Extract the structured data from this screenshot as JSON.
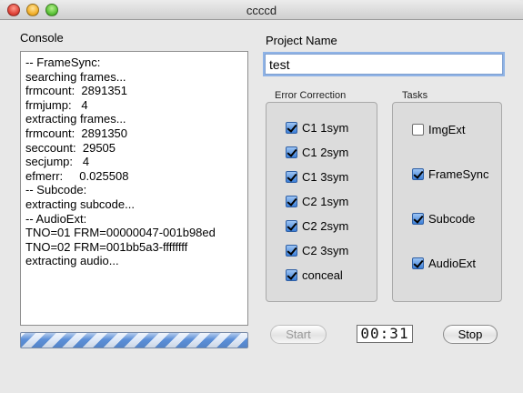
{
  "window": {
    "title": "ccccd"
  },
  "console": {
    "label": "Console",
    "lines": [
      "-- FrameSync:",
      "searching frames...",
      "frmcount:  2891351",
      "frmjump:   4",
      "extracting frames...",
      "frmcount:  2891350",
      "seccount:  29505",
      "secjump:   4",
      "efmerr:     0.025508",
      "-- Subcode:",
      "extracting subcode...",
      "-- AudioExt:",
      "TNO=01 FRM=00000047-001b98ed",
      "TNO=02 FRM=001bb5a3-ffffffff",
      "extracting audio..."
    ],
    "progress": "indeterminate"
  },
  "project": {
    "label": "Project Name",
    "value": "test"
  },
  "error_correction": {
    "title": "Error Correction",
    "items": [
      {
        "label": "C1  1sym",
        "checked": true
      },
      {
        "label": "C1  2sym",
        "checked": true
      },
      {
        "label": "C1  3sym",
        "checked": true
      },
      {
        "label": "C2  1sym",
        "checked": true
      },
      {
        "label": "C2  2sym",
        "checked": true
      },
      {
        "label": "C2  3sym",
        "checked": true
      },
      {
        "label": "conceal",
        "checked": true
      }
    ]
  },
  "tasks": {
    "title": "Tasks",
    "items": [
      {
        "label": "ImgExt",
        "checked": false
      },
      {
        "label": "FrameSync",
        "checked": true
      },
      {
        "label": "Subcode",
        "checked": true
      },
      {
        "label": "AudioExt",
        "checked": true
      }
    ]
  },
  "controls": {
    "start_label": "Start",
    "stop_label": "Stop",
    "timer": "00:31"
  }
}
